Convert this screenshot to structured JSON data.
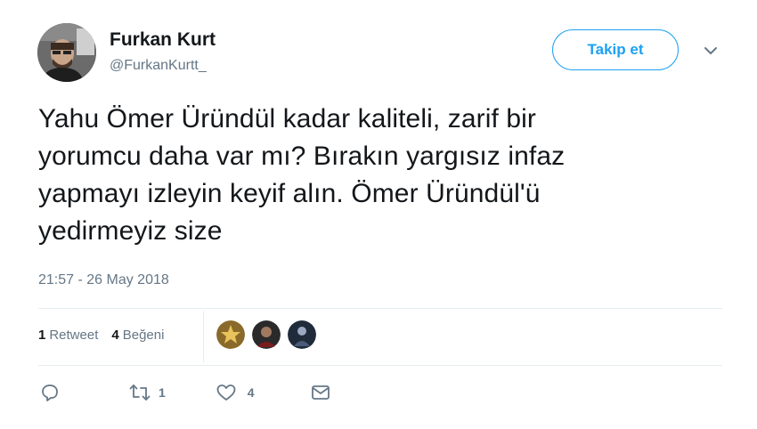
{
  "user": {
    "name": "Furkan Kurt",
    "handle": "@FurkanKurtt_"
  },
  "follow_label": "Takip et",
  "tweet": {
    "line1": "Yahu Ömer Üründül kadar kaliteli, zarif bir",
    "line2": "yorumcu daha var mı? Bırakın yargısız infaz",
    "line3": "yapmayı izleyin keyif alın. Ömer Üründül'ü",
    "line4": "yedirmeyiz size",
    "timestamp": "21:57 - 26 May 2018"
  },
  "stats": {
    "retweet_count": "1",
    "retweet_label": "Retweet",
    "like_count": "4",
    "like_label": "Beğeni"
  },
  "actions": {
    "retweet_count": "1",
    "like_count": "4"
  },
  "icons": {
    "reply": "reply-icon",
    "retweet": "retweet-icon",
    "like": "heart-icon",
    "message": "envelope-icon",
    "caret": "chevron-down-icon"
  },
  "colors": {
    "accent": "#1da1f2",
    "secondary_text": "#657786",
    "divider": "#e6ecf0"
  }
}
